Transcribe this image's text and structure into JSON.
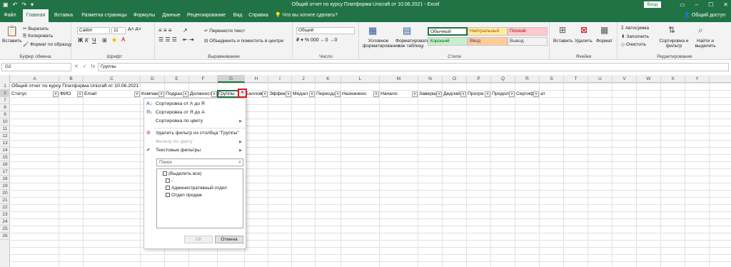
{
  "titlebar": {
    "title": "Общий отчет по курсу Платформа Unicraft от 10.06.2021 - Excel",
    "login_button": "Вход",
    "share": "Общий доступ",
    "icons": [
      "save-icon",
      "undo-icon",
      "redo-icon",
      "customize-qat-icon"
    ]
  },
  "tabs": {
    "items": [
      "Файл",
      "Главная",
      "Вставка",
      "Разметка страницы",
      "Формулы",
      "Данные",
      "Рецензирование",
      "Вид",
      "Справка"
    ],
    "active": "Главная",
    "tell_me": "Что вы хотите сделать?"
  },
  "ribbon": {
    "clipboard": {
      "paste": "Вставить",
      "cut": "Вырезать",
      "copy": "Копировать",
      "format_painter": "Формат по образцу",
      "label": "Буфер обмена"
    },
    "font": {
      "name": "Calibri",
      "size": "11",
      "label": "Шрифт"
    },
    "alignment": {
      "wrap": "Перенести текст",
      "merge": "Объединить и поместить в центре",
      "label": "Выравнивание"
    },
    "number": {
      "format": "Общий",
      "label": "Число"
    },
    "styles": {
      "conditional": "Условное форматирование",
      "as_table": "Форматировать как таблицу",
      "cells": [
        "Обычный",
        "Нейтральный",
        "Плохой",
        "Хороший",
        "Ввод",
        "Вывод"
      ],
      "label": "Стили"
    },
    "cells_group": {
      "insert": "Вставить",
      "delete": "Удалить",
      "format": "Формат",
      "label": "Ячейки"
    },
    "editing": {
      "autosum": "Автосумма",
      "fill": "Заполнить",
      "clear": "Очистить",
      "sort": "Сортировка и фильтр",
      "find": "Найти и выделить",
      "label": "Редактирование"
    }
  },
  "formula_bar": {
    "name_box": "G2",
    "value": "Группы"
  },
  "grid": {
    "columns": [
      "A",
      "B",
      "C",
      "D",
      "E",
      "F",
      "G",
      "H",
      "I",
      "J",
      "K",
      "L",
      "M",
      "N",
      "O",
      "P",
      "Q",
      "R",
      "S",
      "T",
      "U",
      "V",
      "W",
      "X",
      "Y"
    ],
    "active_column": "G",
    "rows": [
      "1",
      "2",
      "7",
      "8",
      "9",
      "10",
      "11",
      "12",
      "13",
      "14",
      "15",
      "16",
      "17",
      "18",
      "19",
      "20",
      "21",
      "22",
      "23",
      "24",
      "25",
      "26"
    ],
    "row1_text": "Общий отчет по курсу Платформа Unicraft от 10.06.2021",
    "headers": [
      "Статус",
      "ФИО",
      "Email",
      "Компан",
      "Подраз",
      "Должност",
      "Группы",
      "Баллов",
      "Эффек",
      "Медал",
      "Пересда",
      "Назначено",
      "Начало",
      "Завершен",
      "Дедлай",
      "Прогре",
      "Продол",
      "Сертиф",
      "ат"
    ]
  },
  "filter_menu": {
    "sort_az": "Сортировка от А до Я",
    "sort_za": "Сортировка от Я до А",
    "sort_color": "Сортировка по цвету",
    "clear_filter": "Удалить фильтр из столбца \"Группы\"",
    "filter_color": "Фильтр по цвету",
    "text_filters": "Текстовые фильтры",
    "search_placeholder": "Поиск",
    "list": [
      "(Выделить все)",
      "-",
      "Административный отдел",
      "Отдел продаж"
    ],
    "ok": "ОК",
    "cancel": "Отмена"
  }
}
